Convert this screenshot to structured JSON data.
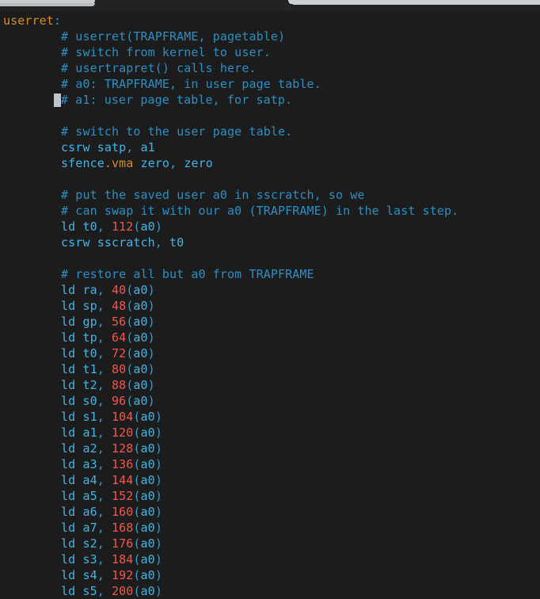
{
  "window": {
    "chrome": {
      "tab_left_name": "tab-partial-left",
      "tab_right_name": "tab-partial-right"
    }
  },
  "editor": {
    "background_color": "#1c1c1c",
    "cursor_color": "#c0c4cc",
    "colors": {
      "label": "#d98c1f",
      "comment": "#2a8fc4",
      "instruction": "#3fb5e8",
      "register": "#3fb5e8",
      "number": "#f4554a",
      "punctuation": "#2e9fd4",
      "extension": "#d98c1f"
    },
    "cursor": {
      "line_index": 5,
      "column": 8
    },
    "lines": [
      {
        "n": 1,
        "indent": 0,
        "text": "userret:"
      },
      {
        "n": 2,
        "indent": 8,
        "text": "# userret(TRAPFRAME, pagetable)"
      },
      {
        "n": 3,
        "indent": 8,
        "text": "# switch from kernel to user."
      },
      {
        "n": 4,
        "indent": 8,
        "text": "# usertrapret() calls here."
      },
      {
        "n": 5,
        "indent": 8,
        "text": "# a0: TRAPFRAME, in user page table."
      },
      {
        "n": 6,
        "indent": 8,
        "text": "# a1: user page table, for satp."
      },
      {
        "n": 7,
        "indent": 0,
        "text": ""
      },
      {
        "n": 8,
        "indent": 8,
        "text": "# switch to the user page table."
      },
      {
        "n": 9,
        "indent": 8,
        "text": "csrw satp, a1"
      },
      {
        "n": 10,
        "indent": 8,
        "text": "sfence.vma zero, zero"
      },
      {
        "n": 11,
        "indent": 0,
        "text": ""
      },
      {
        "n": 12,
        "indent": 8,
        "text": "# put the saved user a0 in sscratch, so we"
      },
      {
        "n": 13,
        "indent": 8,
        "text": "# can swap it with our a0 (TRAPFRAME) in the last step."
      },
      {
        "n": 14,
        "indent": 8,
        "text": "ld t0, 112(a0)"
      },
      {
        "n": 15,
        "indent": 8,
        "text": "csrw sscratch, t0"
      },
      {
        "n": 16,
        "indent": 0,
        "text": ""
      },
      {
        "n": 17,
        "indent": 8,
        "text": "# restore all but a0 from TRAPFRAME"
      },
      {
        "n": 18,
        "indent": 8,
        "text": "ld ra, 40(a0)"
      },
      {
        "n": 19,
        "indent": 8,
        "text": "ld sp, 48(a0)"
      },
      {
        "n": 20,
        "indent": 8,
        "text": "ld gp, 56(a0)"
      },
      {
        "n": 21,
        "indent": 8,
        "text": "ld tp, 64(a0)"
      },
      {
        "n": 22,
        "indent": 8,
        "text": "ld t0, 72(a0)"
      },
      {
        "n": 23,
        "indent": 8,
        "text": "ld t1, 80(a0)"
      },
      {
        "n": 24,
        "indent": 8,
        "text": "ld t2, 88(a0)"
      },
      {
        "n": 25,
        "indent": 8,
        "text": "ld s0, 96(a0)"
      },
      {
        "n": 26,
        "indent": 8,
        "text": "ld s1, 104(a0)"
      },
      {
        "n": 27,
        "indent": 8,
        "text": "ld a1, 120(a0)"
      },
      {
        "n": 28,
        "indent": 8,
        "text": "ld a2, 128(a0)"
      },
      {
        "n": 29,
        "indent": 8,
        "text": "ld a3, 136(a0)"
      },
      {
        "n": 30,
        "indent": 8,
        "text": "ld a4, 144(a0)"
      },
      {
        "n": 31,
        "indent": 8,
        "text": "ld a5, 152(a0)"
      },
      {
        "n": 32,
        "indent": 8,
        "text": "ld a6, 160(a0)"
      },
      {
        "n": 33,
        "indent": 8,
        "text": "ld a7, 168(a0)"
      },
      {
        "n": 34,
        "indent": 8,
        "text": "ld s2, 176(a0)"
      },
      {
        "n": 35,
        "indent": 8,
        "text": "ld s3, 184(a0)"
      },
      {
        "n": 36,
        "indent": 8,
        "text": "ld s4, 192(a0)"
      },
      {
        "n": 37,
        "indent": 8,
        "text": "ld s5, 200(a0)"
      }
    ]
  }
}
